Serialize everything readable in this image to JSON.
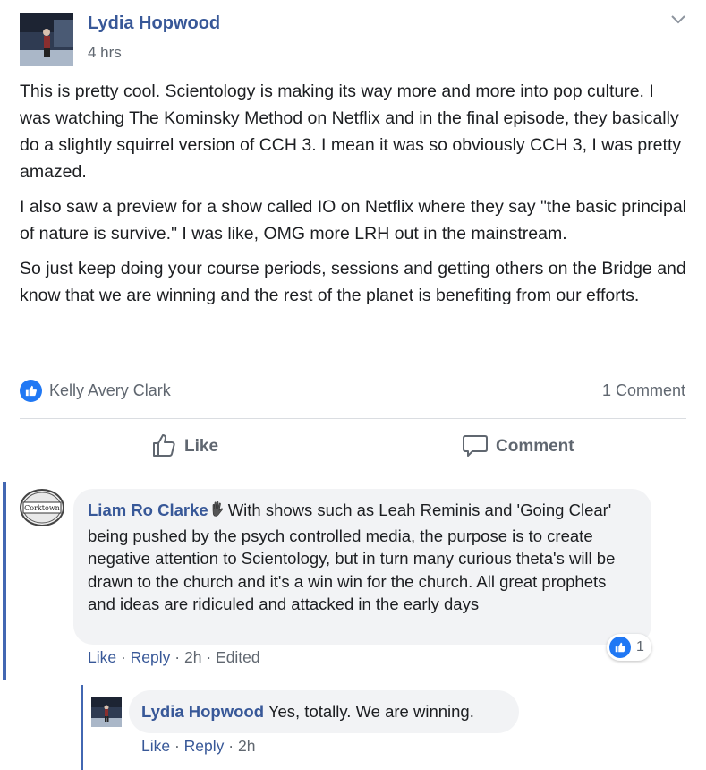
{
  "post": {
    "author": "Lydia Hopwood",
    "time": "4 hrs",
    "paragraphs": [
      "This is pretty cool. Scientology is making its way more and more into pop culture. I was watching The Kominsky Method on Netflix and in the final episode, they basically do a slightly squirrel version of CCH 3. I mean it was so obviously CCH 3, I was pretty amazed.",
      "I also saw a preview for a show called IO on Netflix where they say \"the basic principal of nature is survive.\" I was like, OMG more LRH out in the mainstream.",
      "So just keep doing your course periods, sessions and getting others on the Bridge and know that we are winning and the rest of the planet is benefiting from our efforts."
    ],
    "likers": "Kelly Avery Clark",
    "comment_count": "1 Comment",
    "actions": {
      "like": "Like",
      "comment": "Comment"
    }
  },
  "comments": [
    {
      "author": "Liam Ro Clarke",
      "text": "With shows such as Leah Reminis and 'Going Clear' being pushed by the psych controlled media, the purpose is to create negative attention to Scientology, but in turn many curious theta's will be drawn to the church and it's a win win for the church. All great prophets and ideas are ridiculed and attacked in the early days",
      "like_label": "Like",
      "reply_label": "Reply",
      "time": "2h",
      "edited": "Edited",
      "reaction_count": "1",
      "avatar_text": "Corktown"
    },
    {
      "author": "Lydia Hopwood",
      "text": "Yes, totally. We are winning.",
      "like_label": "Like",
      "reply_label": "Reply",
      "time": "2h"
    }
  ],
  "separator": " · ",
  "colors": {
    "link": "#385898",
    "accent": "#4267b2",
    "like_blue": "#2078f4",
    "muted": "#606770",
    "bubble": "#f2f3f5"
  }
}
